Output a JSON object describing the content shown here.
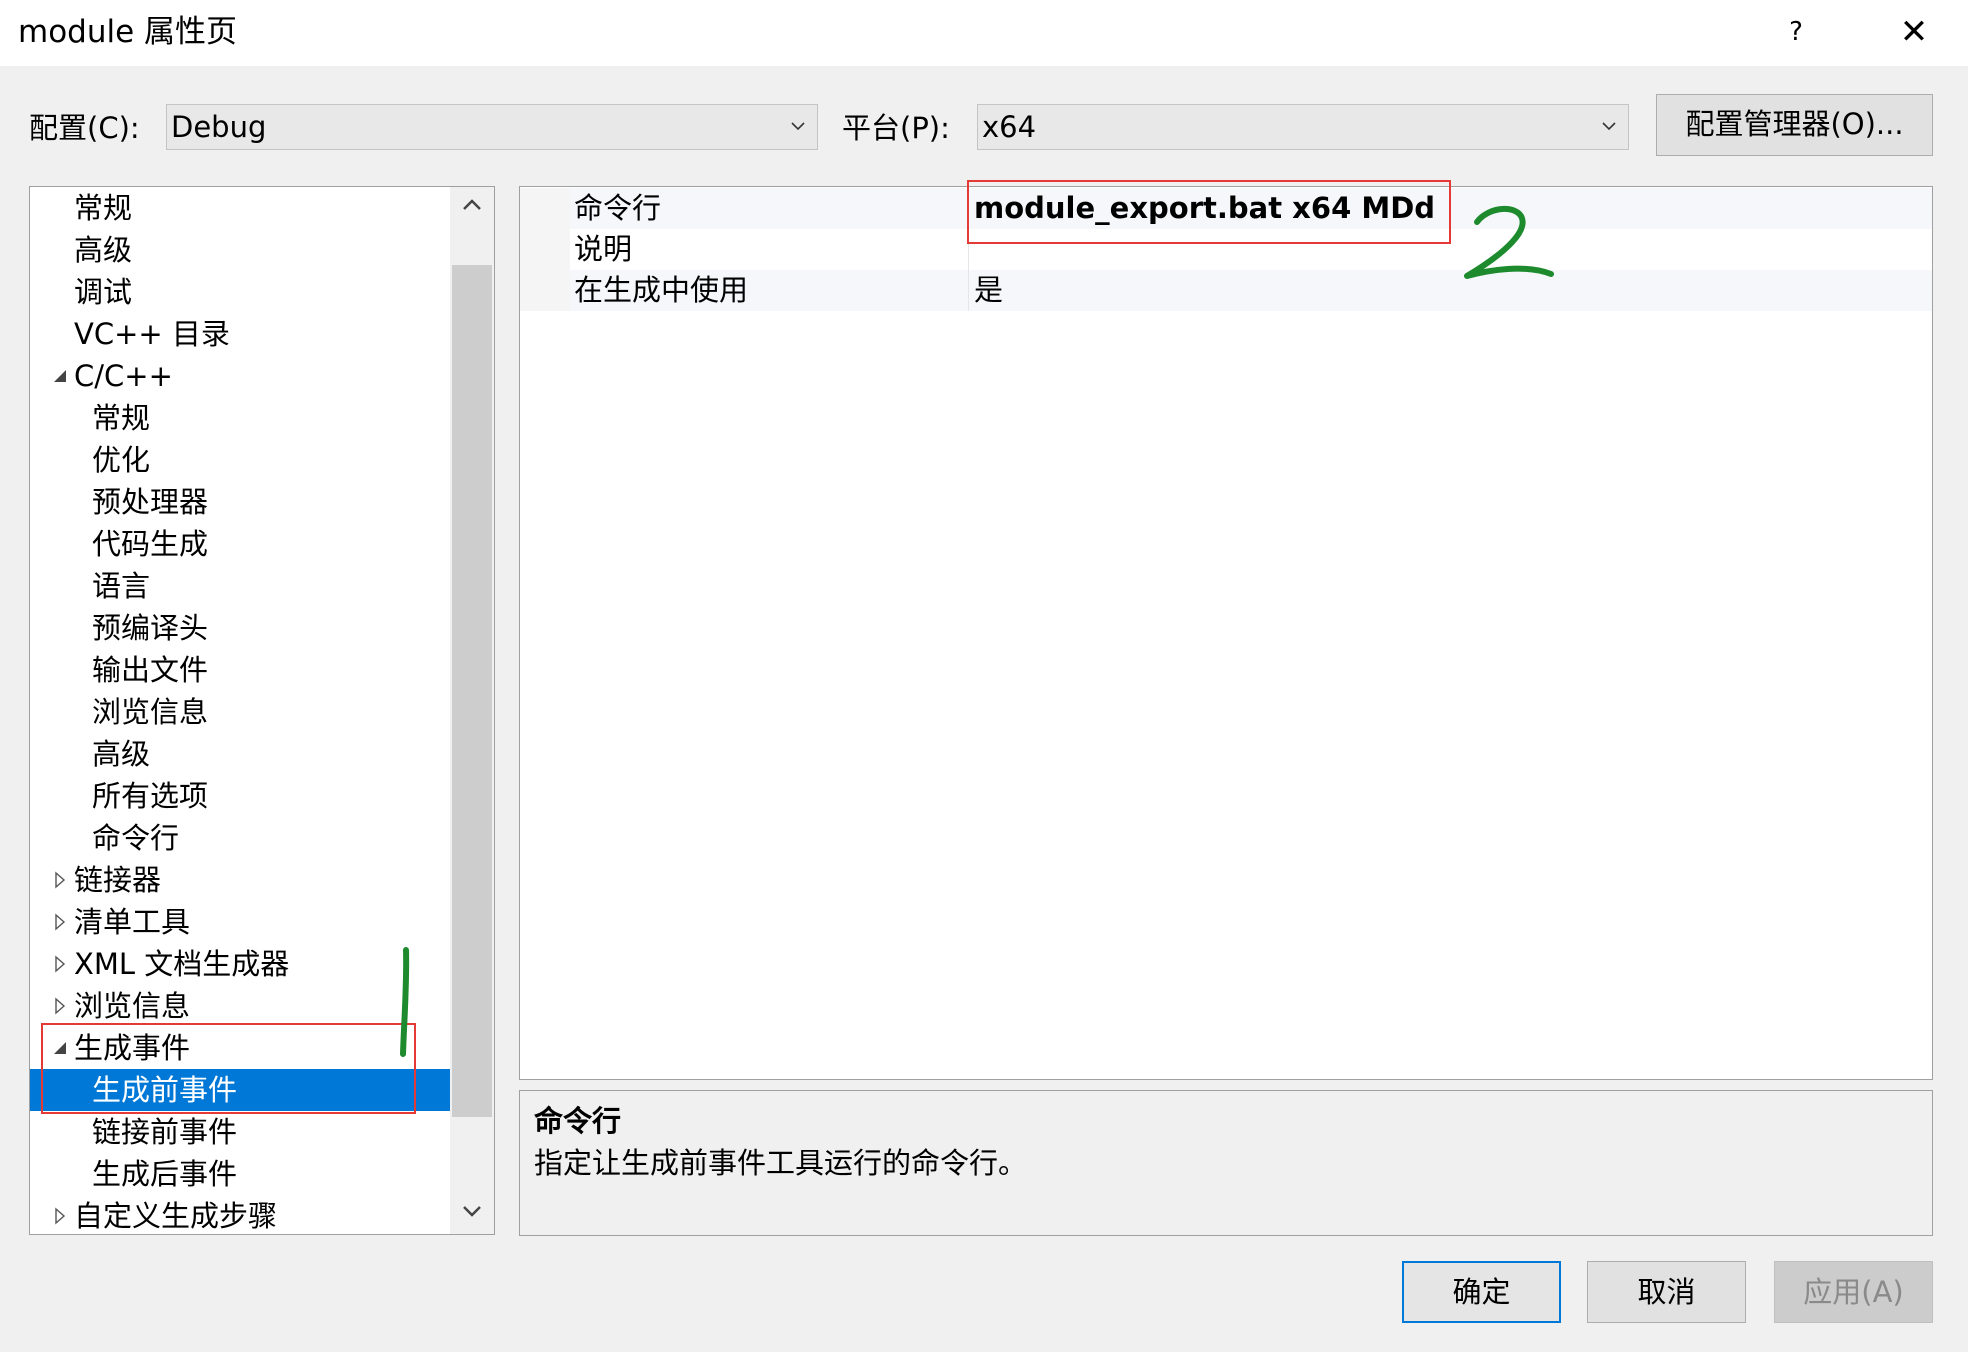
{
  "window": {
    "title": "module 属性页",
    "help_glyph": "?",
    "close_glyph": "✕"
  },
  "toolbar": {
    "config_label": "配置(C):",
    "config_value": "Debug",
    "platform_label": "平台(P):",
    "platform_value": "x64",
    "config_manager_label": "配置管理器(O)..."
  },
  "tree": {
    "items": [
      {
        "label": "常规",
        "level": 1,
        "expander": "none"
      },
      {
        "label": "高级",
        "level": 1,
        "expander": "none"
      },
      {
        "label": "调试",
        "level": 1,
        "expander": "none"
      },
      {
        "label": "VC++ 目录",
        "level": 1,
        "expander": "none"
      },
      {
        "label": "C/C++",
        "level": 1,
        "expander": "expanded"
      },
      {
        "label": "常规",
        "level": 2,
        "expander": "none"
      },
      {
        "label": "优化",
        "level": 2,
        "expander": "none"
      },
      {
        "label": "预处理器",
        "level": 2,
        "expander": "none"
      },
      {
        "label": "代码生成",
        "level": 2,
        "expander": "none"
      },
      {
        "label": "语言",
        "level": 2,
        "expander": "none"
      },
      {
        "label": "预编译头",
        "level": 2,
        "expander": "none"
      },
      {
        "label": "输出文件",
        "level": 2,
        "expander": "none"
      },
      {
        "label": "浏览信息",
        "level": 2,
        "expander": "none"
      },
      {
        "label": "高级",
        "level": 2,
        "expander": "none"
      },
      {
        "label": "所有选项",
        "level": 2,
        "expander": "none"
      },
      {
        "label": "命令行",
        "level": 2,
        "expander": "none"
      },
      {
        "label": "链接器",
        "level": 1,
        "expander": "collapsed"
      },
      {
        "label": "清单工具",
        "level": 1,
        "expander": "collapsed"
      },
      {
        "label": "XML 文档生成器",
        "level": 1,
        "expander": "collapsed"
      },
      {
        "label": "浏览信息",
        "level": 1,
        "expander": "collapsed"
      },
      {
        "label": "生成事件",
        "level": 1,
        "expander": "expanded"
      },
      {
        "label": "生成前事件",
        "level": 2,
        "expander": "none",
        "selected": true
      },
      {
        "label": "链接前事件",
        "level": 2,
        "expander": "none"
      },
      {
        "label": "生成后事件",
        "level": 2,
        "expander": "none"
      },
      {
        "label": "自定义生成步骤",
        "level": 1,
        "expander": "collapsed"
      }
    ]
  },
  "grid": {
    "rows": [
      {
        "name": "命令行",
        "value": "module_export.bat x64 MDd",
        "bold": true
      },
      {
        "name": "说明",
        "value": ""
      },
      {
        "name": "在生成中使用",
        "value": "是"
      }
    ]
  },
  "description": {
    "title": "命令行",
    "body": "指定让生成前事件工具运行的命令行。"
  },
  "buttons": {
    "ok": "确定",
    "cancel": "取消",
    "apply": "应用(A)"
  },
  "annotations": {
    "mark_1": "1",
    "mark_2": "2",
    "mark_color": "#1e8a2e",
    "box_color": "#e53935"
  }
}
